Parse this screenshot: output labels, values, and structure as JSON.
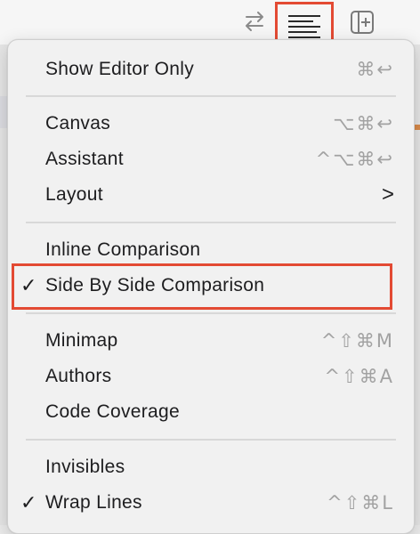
{
  "colors": {
    "highlight": "#e34a33",
    "text": "#1d1d1f",
    "shortcut": "#a2a2a2",
    "menu_bg": "#f1f1f1"
  },
  "toolbar": {
    "icons": [
      "swap-arrows-icon",
      "editor-options-icon",
      "add-editor-icon"
    ]
  },
  "menu": {
    "show_editor_only": {
      "label": "Show Editor Only",
      "shortcut": "⌘↩"
    },
    "canvas": {
      "label": "Canvas",
      "shortcut": "⌥⌘↩"
    },
    "assistant": {
      "label": "Assistant",
      "shortcut": "^⌥⌘↩"
    },
    "layout": {
      "label": "Layout",
      "submenu": ">"
    },
    "inline_comparison": {
      "label": "Inline Comparison"
    },
    "side_by_side": {
      "label": "Side By Side Comparison",
      "checked": true,
      "check": "✓"
    },
    "minimap": {
      "label": "Minimap",
      "shortcut": "^⇧⌘M"
    },
    "authors": {
      "label": "Authors",
      "shortcut": "^⇧⌘A"
    },
    "code_coverage": {
      "label": "Code Coverage"
    },
    "invisibles": {
      "label": "Invisibles"
    },
    "wrap_lines": {
      "label": "Wrap Lines",
      "checked": true,
      "check": "✓",
      "shortcut": "^⇧⌘L"
    }
  }
}
